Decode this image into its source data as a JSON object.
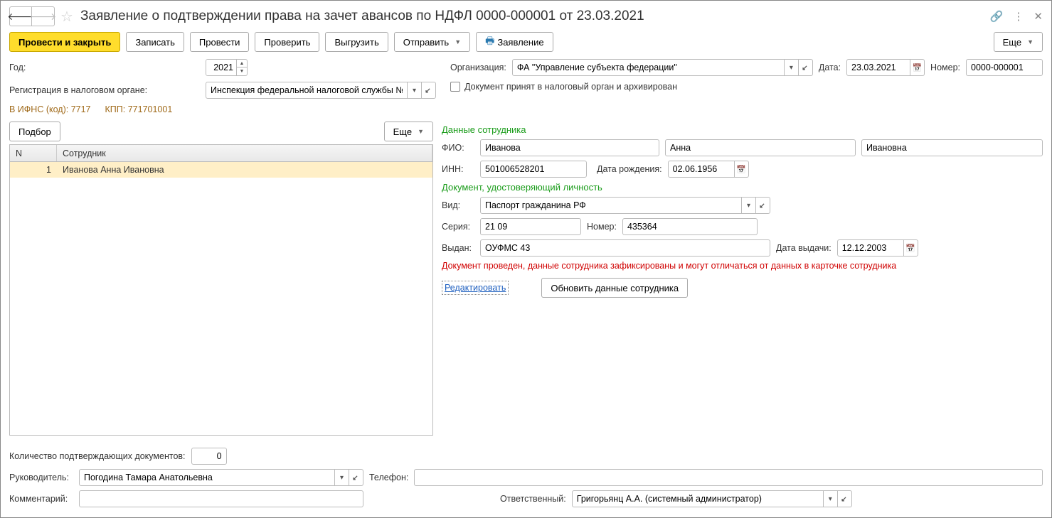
{
  "title": "Заявление о подтверждении права на зачет авансов по НДФЛ 0000-000001 от 23.03.2021",
  "toolbar": {
    "post_and_close": "Провести и закрыть",
    "save": "Записать",
    "post": "Провести",
    "check": "Проверить",
    "export": "Выгрузить",
    "send": "Отправить",
    "application": "Заявление",
    "more": "Еще"
  },
  "labels": {
    "year": "Год:",
    "organization": "Организация:",
    "date": "Дата:",
    "number": "Номер:",
    "registration": "Регистрация в налоговом органе:",
    "archived": "Документ принят в налоговый орган и архивирован",
    "ifns_code_label": "В ИФНС (код):",
    "kpp_label": "КПП:",
    "select": "Подбор",
    "more_small": "Еще",
    "col_n": "N",
    "col_employee": "Сотрудник",
    "doc_count": "Количество подтверждающих документов:",
    "manager": "Руководитель:",
    "phone": "Телефон:",
    "comment": "Комментарий:",
    "responsible": "Ответственный:"
  },
  "info": {
    "ifns_code": "7717",
    "kpp": "771701001"
  },
  "values": {
    "year": "2021",
    "organization": "ФА \"Управление субъекта федерации\"",
    "date": "23.03.2021",
    "number": "0000-000001",
    "registration": "Инспекция федеральной налоговой службы №",
    "doc_count": "0",
    "manager": "Погодина Тамара Анатольевна",
    "phone": "",
    "comment": "",
    "responsible": "Григорьянц А.А. (системный администратор)"
  },
  "table": {
    "rows": [
      {
        "n": "1",
        "employee": "Иванова Анна Ивановна"
      }
    ]
  },
  "employee_section": {
    "title": "Данные сотрудника",
    "fio_label": "ФИО:",
    "lastname": "Иванова",
    "firstname": "Анна",
    "patronymic": "Ивановна",
    "inn_label": "ИНН:",
    "inn": "501006528201",
    "birth_label": "Дата рождения:",
    "birth": "02.06.1956"
  },
  "document_section": {
    "title": "Документ, удостоверяющий личность",
    "type_label": "Вид:",
    "type": "Паспорт гражданина РФ",
    "series_label": "Серия:",
    "series": "21 09",
    "number_label": "Номер:",
    "number": "435364",
    "issued_by_label": "Выдан:",
    "issued_by": "ОУФМС 43",
    "issue_date_label": "Дата выдачи:",
    "issue_date": "12.12.2003",
    "warning": "Документ проведен, данные сотрудника зафиксированы и могут отличаться от данных в карточке сотрудника",
    "edit_link": "Редактировать",
    "refresh_btn": "Обновить данные сотрудника"
  }
}
